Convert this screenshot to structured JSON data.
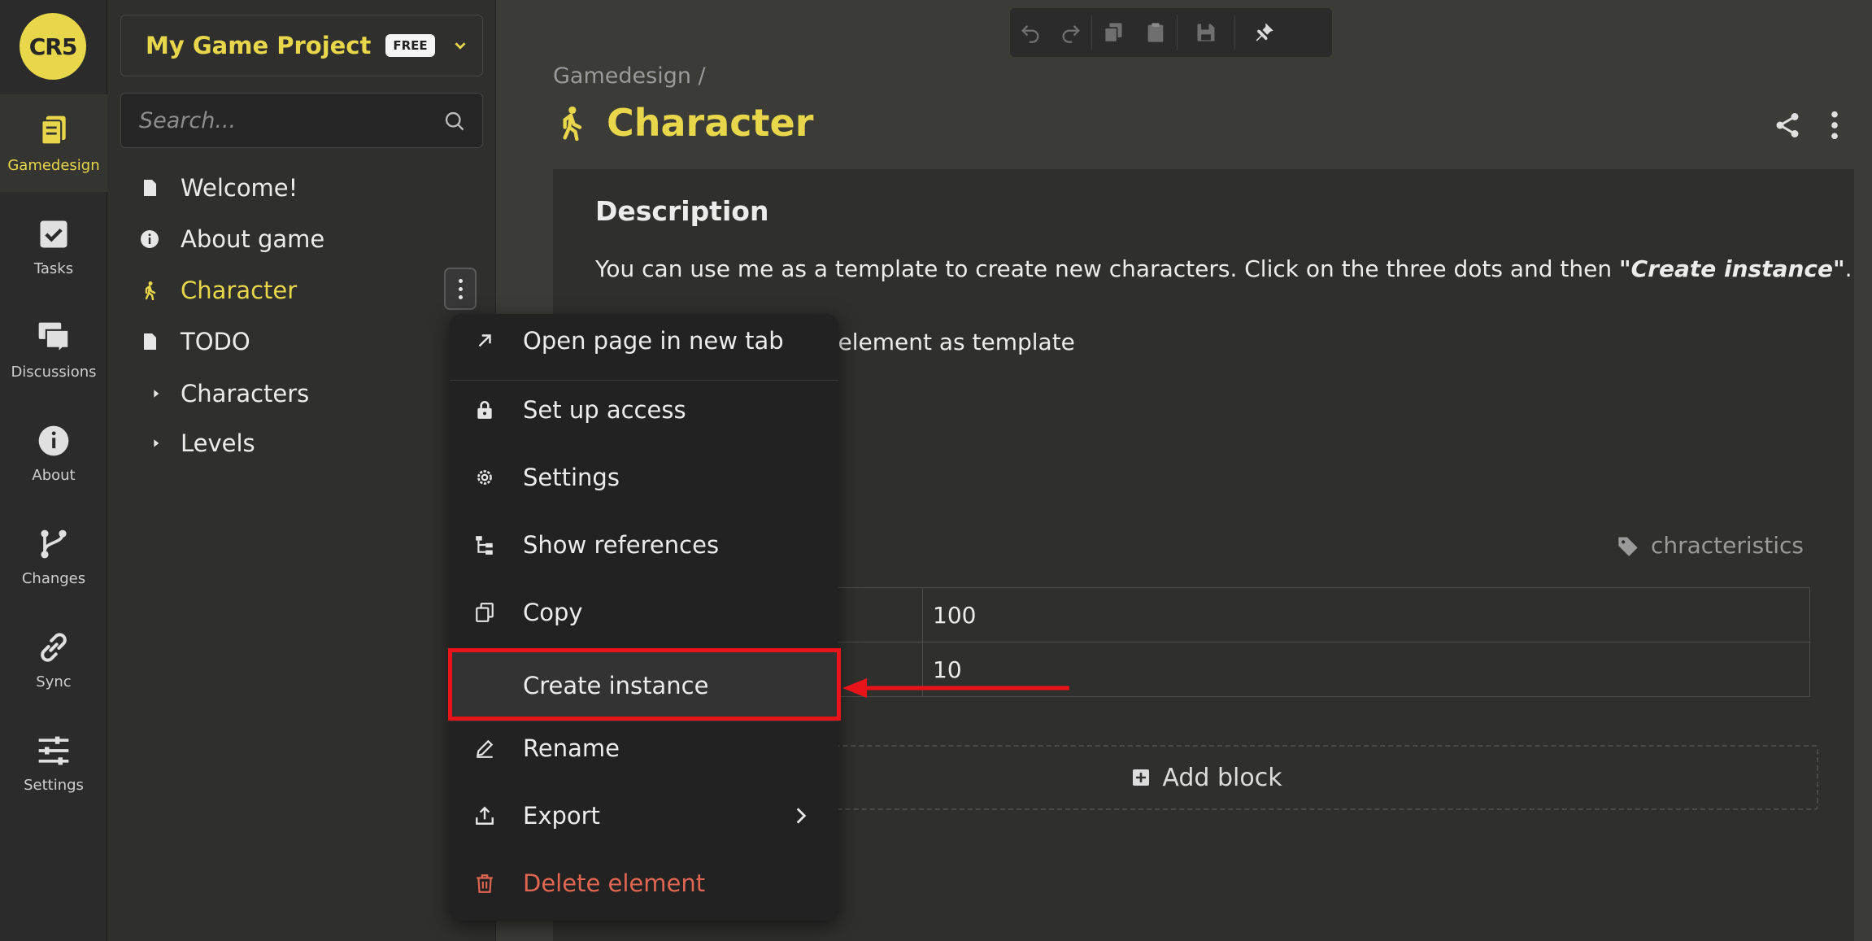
{
  "rail": {
    "logo_text": "CR5",
    "items": [
      {
        "label": "Gamedesign",
        "icon": "pages-icon"
      },
      {
        "label": "Tasks",
        "icon": "checkbox-icon"
      },
      {
        "label": "Discussions",
        "icon": "chat-icon"
      },
      {
        "label": "About",
        "icon": "info-icon"
      },
      {
        "label": "Changes",
        "icon": "branch-icon"
      },
      {
        "label": "Sync",
        "icon": "link-icon"
      },
      {
        "label": "Settings",
        "icon": "sliders-icon"
      }
    ],
    "active": "Gamedesign"
  },
  "sidebar": {
    "project_name": "My Game Project",
    "plan_badge": "FREE",
    "search_placeholder": "Search...",
    "tree": [
      {
        "label": "Welcome!",
        "icon": "page-icon"
      },
      {
        "label": "About game",
        "icon": "info-icon"
      },
      {
        "label": "Character",
        "icon": "walking-figure-icon",
        "active": true
      },
      {
        "label": "TODO",
        "icon": "page-icon"
      },
      {
        "label": "Characters",
        "icon": "caret-right-icon"
      },
      {
        "label": "Levels",
        "icon": "caret-right-icon"
      }
    ]
  },
  "main": {
    "breadcrumb": "Gamedesign /",
    "title": "Character",
    "description_heading": "Description",
    "description_text": "You can use me as a template to create new characters. Click on the three dots and then ",
    "description_emphasis": "\"Create instance\"",
    "description_end": ".",
    "description_text2_visible": "e any element as template",
    "faded_heading": "",
    "faded_box": "",
    "faded_sub": "",
    "tag_label": "chracteristics",
    "table_rows": [
      {
        "key": "",
        "value": "100"
      },
      {
        "key": "",
        "value": "10"
      }
    ],
    "add_block_label": "Add block"
  },
  "context_menu": {
    "items": [
      {
        "label": "Open page in new tab",
        "icon": "arrow-up-right-icon"
      },
      {
        "label": "Set up access",
        "icon": "lock-icon"
      },
      {
        "label": "Settings",
        "icon": "gear-icon"
      },
      {
        "label": "Show references",
        "icon": "tree-references-icon"
      },
      {
        "label": "Copy",
        "icon": "copy-icon"
      },
      {
        "label": "Create instance",
        "icon": "",
        "highlighted": true
      },
      {
        "label": "Rename",
        "icon": "pencil-icon"
      },
      {
        "label": "Export",
        "icon": "upload-icon",
        "has_submenu": true
      },
      {
        "label": "Delete element",
        "icon": "trash-icon",
        "danger": true
      }
    ]
  },
  "colors": {
    "accent": "#e8d64b",
    "danger": "#e06652",
    "annotation_red": "#e8141a",
    "background": "#3b3b38"
  }
}
